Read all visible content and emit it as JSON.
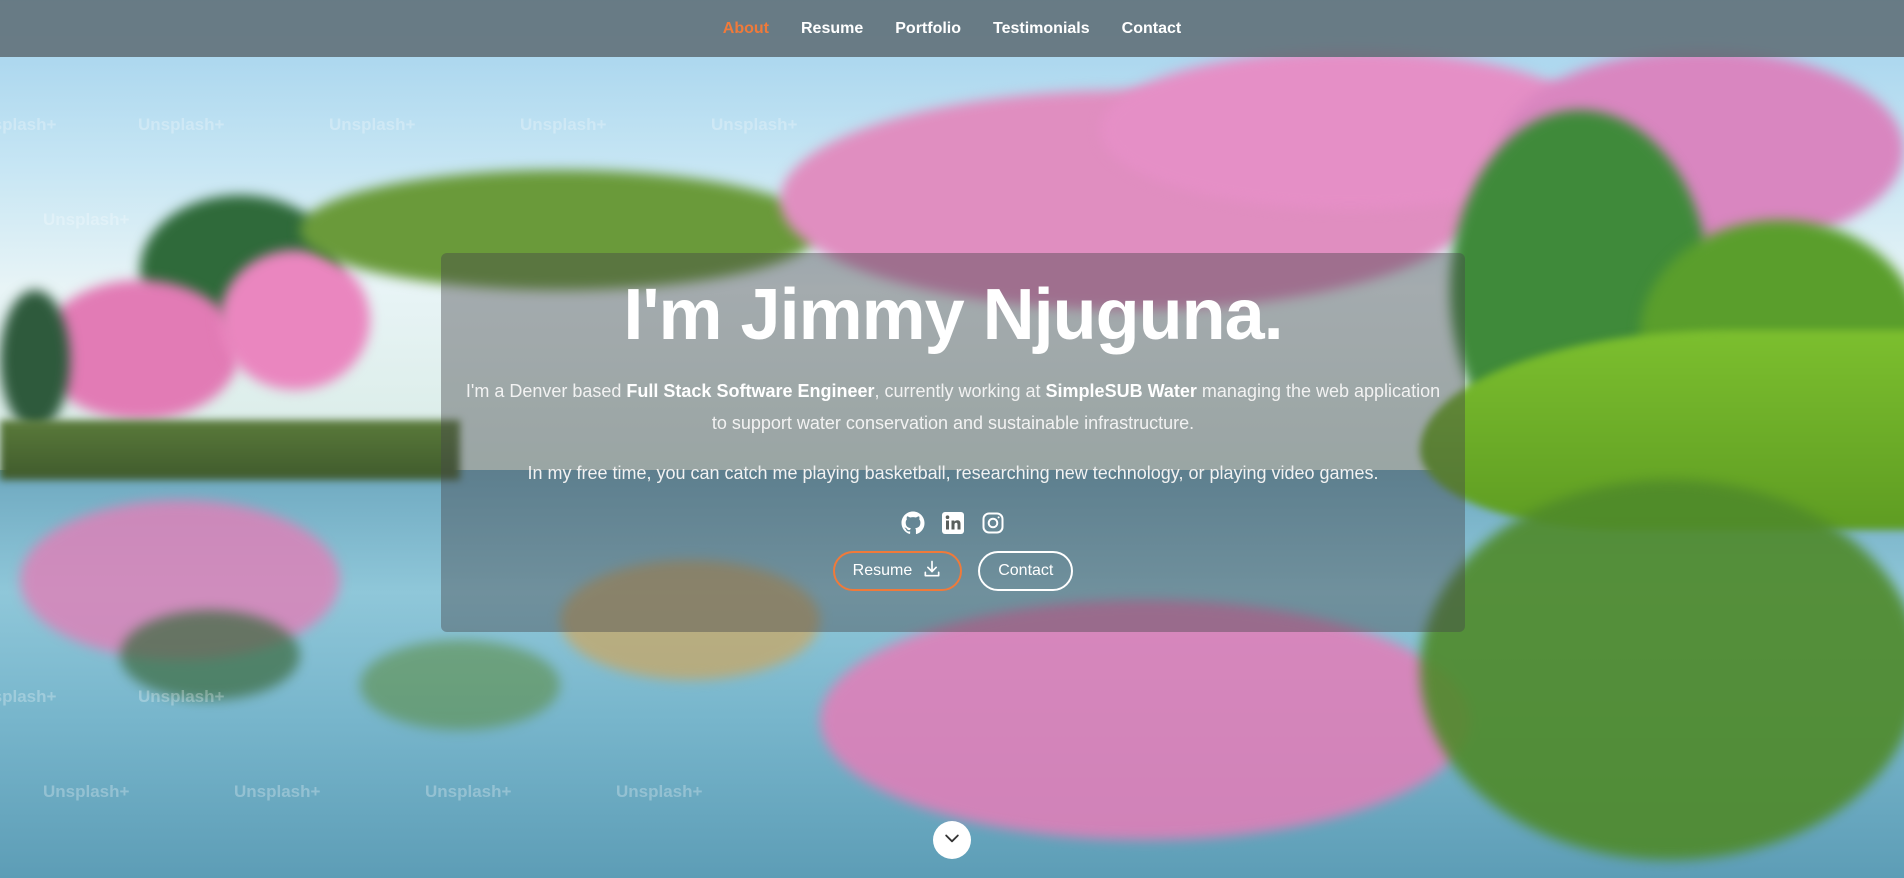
{
  "nav": {
    "items": [
      {
        "label": "About",
        "active": true
      },
      {
        "label": "Resume",
        "active": false
      },
      {
        "label": "Portfolio",
        "active": false
      },
      {
        "label": "Testimonials",
        "active": false
      },
      {
        "label": "Contact",
        "active": false
      }
    ]
  },
  "hero": {
    "title": "I'm Jimmy Njuguna.",
    "bio": {
      "part1": "I'm a Denver based ",
      "role": "Full Stack Software Engineer",
      "part2": ", currently working at ",
      "company": "SimpleSUB Water",
      "part3": " managing the web application to support water conservation and sustainable infrastructure."
    },
    "free_time": "In my free time, you can catch me playing basketball, researching new technology, or playing video games.",
    "socials": [
      {
        "icon": "github-icon"
      },
      {
        "icon": "linkedin-icon"
      },
      {
        "icon": "instagram-icon"
      }
    ],
    "buttons": {
      "resume_label": "Resume",
      "contact_label": "Contact"
    }
  },
  "background": {
    "watermark_text": "Unsplash+"
  },
  "colors": {
    "accent": "#f07a3a",
    "nav_bg": "#606e76",
    "text": "#ffffff"
  }
}
